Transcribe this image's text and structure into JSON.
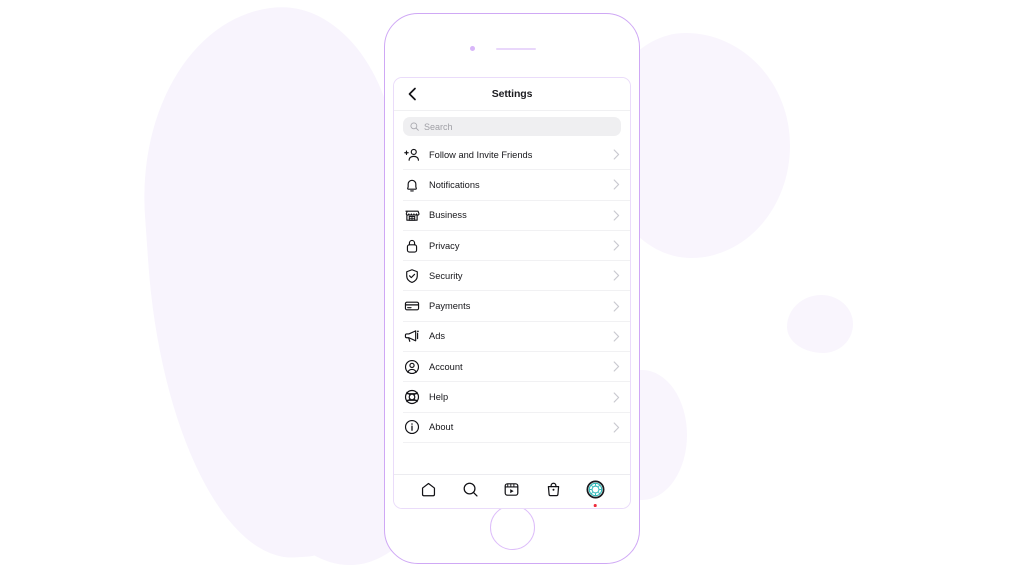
{
  "app": {
    "title": "Settings",
    "back_icon": "chevron-left-icon"
  },
  "search": {
    "placeholder": "Search",
    "value": "",
    "icon": "search-icon"
  },
  "settings_items": [
    {
      "label": "Follow and Invite Friends",
      "icon": "add-person-icon",
      "chevron": "chevron-right-icon"
    },
    {
      "label": "Notifications",
      "icon": "bell-icon",
      "chevron": "chevron-right-icon"
    },
    {
      "label": "Business",
      "icon": "storefront-icon",
      "chevron": "chevron-right-icon"
    },
    {
      "label": "Privacy",
      "icon": "lock-icon",
      "chevron": "chevron-right-icon"
    },
    {
      "label": "Security",
      "icon": "shield-check-icon",
      "chevron": "chevron-right-icon"
    },
    {
      "label": "Payments",
      "icon": "credit-card-icon",
      "chevron": "chevron-right-icon"
    },
    {
      "label": "Ads",
      "icon": "megaphone-icon",
      "chevron": "chevron-right-icon"
    },
    {
      "label": "Account",
      "icon": "user-circle-icon",
      "chevron": "chevron-right-icon"
    },
    {
      "label": "Help",
      "icon": "lifebuoy-icon",
      "chevron": "chevron-right-icon"
    },
    {
      "label": "About",
      "icon": "info-circle-icon",
      "chevron": "chevron-right-icon"
    }
  ],
  "bottom_nav": [
    {
      "name": "home",
      "icon": "home-icon"
    },
    {
      "name": "search",
      "icon": "search-icon"
    },
    {
      "name": "reels",
      "icon": "reels-play-icon"
    },
    {
      "name": "shop",
      "icon": "shopping-bag-icon"
    },
    {
      "name": "profile",
      "icon": "profile-avatar-icon",
      "badge": true
    }
  ],
  "colors": {
    "phone_frame": "#cfa8f5",
    "background_blob": "#f8f4fd",
    "search_field": "#efeff1",
    "text_primary": "#16161a",
    "text_placeholder": "#a0a0a6",
    "chevron": "#c8c8cf",
    "avatar_ring": "#1a1a1e",
    "avatar_inner": "#2fb8b8",
    "badge_dot": "#ee2b3d"
  }
}
